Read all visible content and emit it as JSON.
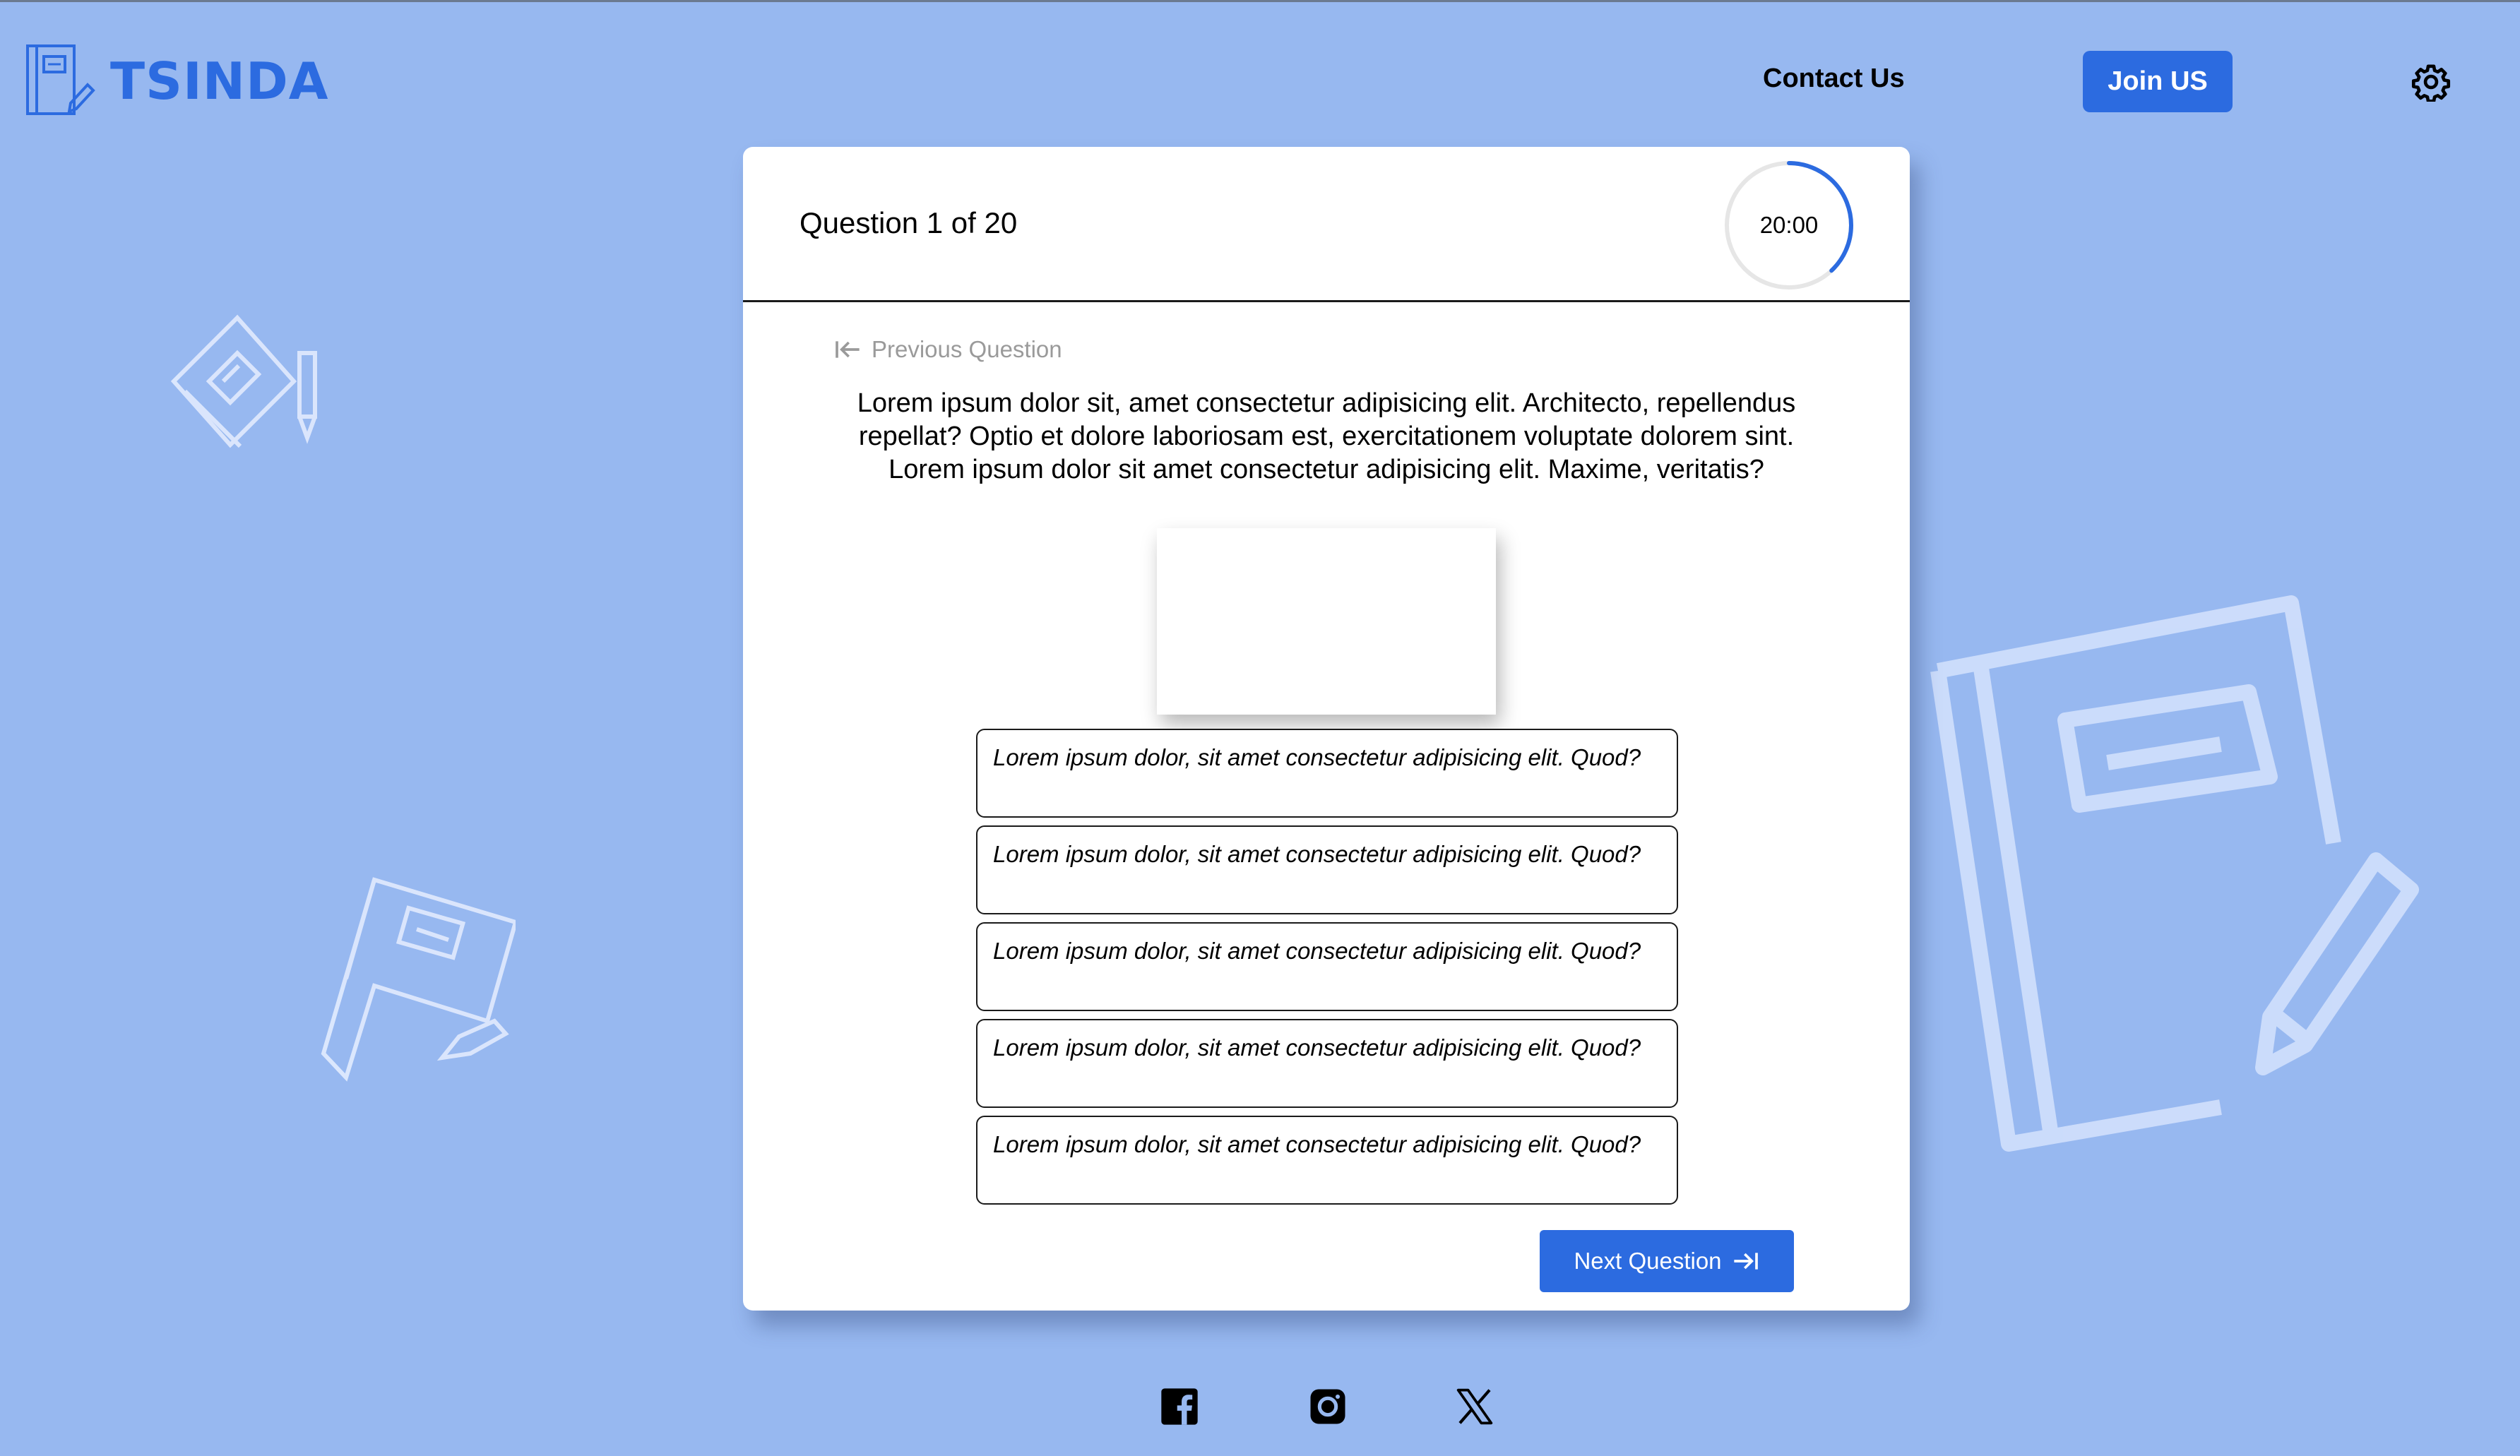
{
  "header": {
    "brand": "TSINDA",
    "contact_label": "Contact Us",
    "join_label": "Join US",
    "settings_icon": "gear-icon"
  },
  "quiz": {
    "question_count": "Question 1 of 20",
    "timer": {
      "text": "20:00",
      "remaining_fraction": 0.38
    },
    "previous_label": "Previous Question",
    "question_text": "Lorem ipsum dolor sit, amet consectetur adipisicing elit. Architecto, repellendus repellat? Optio et dolore laboriosam est, exercitationem voluptate dolorem sint. Lorem ipsum dolor sit amet consectetur adipisicing elit. Maxime, veritatis?",
    "answers": [
      "Lorem ipsum dolor, sit amet consectetur adipisicing elit. Quod?",
      "Lorem ipsum dolor, sit amet consectetur adipisicing elit. Quod?",
      "Lorem ipsum dolor, sit amet consectetur adipisicing elit. Quod?",
      "Lorem ipsum dolor, sit amet consectetur adipisicing elit. Quod?",
      "Lorem ipsum dolor, sit amet consectetur adipisicing elit. Quod?"
    ],
    "next_label": "Next Question"
  },
  "footer": {
    "social_icons": [
      "facebook-icon",
      "instagram-icon",
      "x-icon"
    ]
  },
  "colors": {
    "background": "#97b8f0",
    "accent": "#2c6be0",
    "card": "#ffffff"
  }
}
